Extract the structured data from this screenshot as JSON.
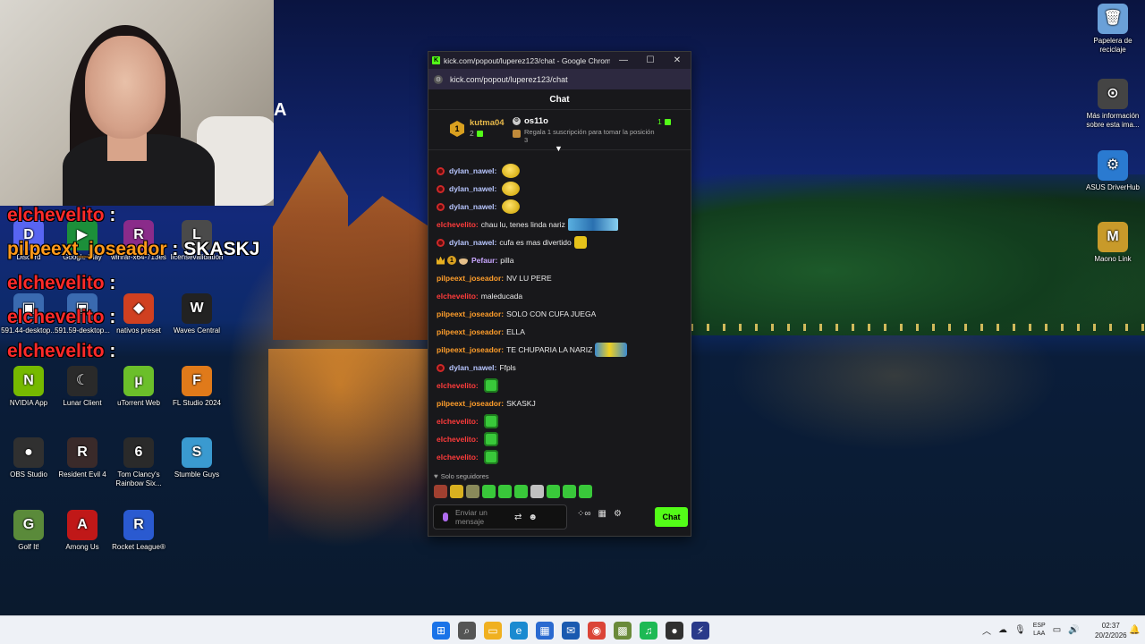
{
  "stream_overlay": {
    "letter": "A",
    "chat_lines": [
      {
        "user": "elchevelito",
        "sep": " : ",
        "text": "",
        "user_class": "user-red"
      },
      {
        "user": "pilpeext_joseador",
        "sep": " : ",
        "text": "SKASKJ",
        "user_class": "user-orange"
      },
      {
        "user": "elchevelito",
        "sep": " : ",
        "text": "",
        "user_class": "user-red"
      },
      {
        "user": "elchevelito",
        "sep": " : ",
        "text": "",
        "user_class": "user-red"
      },
      {
        "user": "elchevelito",
        "sep": " : ",
        "text": "",
        "user_class": "user-red"
      }
    ]
  },
  "desktop_icons": [
    {
      "name": "discord-icon",
      "label": "Discord",
      "color": "#5865f2",
      "glyph": "D"
    },
    {
      "name": "google-play-icon",
      "label": "Google Play",
      "color": "#1c8f3a",
      "glyph": "▶"
    },
    {
      "name": "winrar-icon",
      "label": "winrar-x64-713es",
      "color": "#8a2b8a",
      "glyph": "R"
    },
    {
      "name": "license-icon",
      "label": "licensevalidation",
      "color": "#4a4a4a",
      "glyph": "L"
    },
    {
      "name": "desktop-shortcut-icon",
      "label": "591.44-desktop...",
      "color": "#3a6ab0",
      "glyph": "▣"
    },
    {
      "name": "desktop-shortcut2-icon",
      "label": "591.59-desktop...",
      "color": "#3a6ab0",
      "glyph": "▣"
    },
    {
      "name": "nativos-preset-icon",
      "label": "nativos preset",
      "color": "#d04020",
      "glyph": "◆"
    },
    {
      "name": "waves-icon",
      "label": "Waves Central",
      "color": "#222222",
      "glyph": "W"
    },
    {
      "name": "nvidia-icon",
      "label": "NVIDIA App",
      "color": "#76b900",
      "glyph": "N"
    },
    {
      "name": "lunar-client-icon",
      "label": "Lunar Client",
      "color": "#2a2a2a",
      "glyph": "☾"
    },
    {
      "name": "utorrent-icon",
      "label": "uTorrent Web",
      "color": "#6bbf2a",
      "glyph": "µ"
    },
    {
      "name": "fl-studio-icon",
      "label": "FL Studio 2024",
      "color": "#e07a1a",
      "glyph": "F"
    },
    {
      "name": "obs-icon",
      "label": "OBS Studio",
      "color": "#303030",
      "glyph": "●"
    },
    {
      "name": "resident-evil-icon",
      "label": "Resident Evil 4",
      "color": "#3a2a2a",
      "glyph": "R"
    },
    {
      "name": "rainbow-six-icon",
      "label": "Tom Clancy's Rainbow Six...",
      "color": "#2a2a2a",
      "glyph": "6"
    },
    {
      "name": "stumble-guys-icon",
      "label": "Stumble Guys",
      "color": "#3a9ad0",
      "glyph": "S"
    },
    {
      "name": "golf-it-icon",
      "label": "Golf It!",
      "color": "#5a8a3a",
      "glyph": "G"
    },
    {
      "name": "among-us-icon",
      "label": "Among Us",
      "color": "#c01818",
      "glyph": "A"
    },
    {
      "name": "rocket-league-icon",
      "label": "Rocket League®",
      "color": "#2a5ad0",
      "glyph": "R"
    },
    {
      "name": "recycle-bin-icon",
      "label": "Papelera de reciclaje",
      "color": "#6aa0d8",
      "glyph": "🗑"
    },
    {
      "name": "info-icon",
      "label": "Más información sobre esta ima...",
      "color": "#444444",
      "glyph": "⊙"
    },
    {
      "name": "asus-driverhub-icon",
      "label": "ASUS DriverHub",
      "color": "#2a7ad0",
      "glyph": "⚙"
    },
    {
      "name": "maono-link-icon",
      "label": "Maono Link",
      "color": "#c89a2a",
      "glyph": "M"
    }
  ],
  "window": {
    "title": "kick.com/popout/luperez123/chat - Google Chrome",
    "url": "kick.com/popout/luperez123/chat",
    "minimize": "—",
    "maximize": "☐",
    "close": "✕"
  },
  "chat": {
    "header": "Chat",
    "leaderboard": {
      "rank": "1",
      "top_user": "kutma04",
      "top_count": "2",
      "second_user": "os11o",
      "second_hint": "Regala 1 suscripción para tomar la posición 3",
      "second_count": "1"
    },
    "messages": [
      {
        "badge": "kick",
        "user": "dylan_nawel",
        "user_class": "u-dylan",
        "text": "",
        "emote": "yellow"
      },
      {
        "badge": "kick",
        "user": "dylan_nawel",
        "user_class": "u-dylan",
        "text": "",
        "emote": "yellow"
      },
      {
        "badge": "kick",
        "user": "dylan_nawel",
        "user_class": "u-dylan",
        "text": "",
        "emote": "yellow"
      },
      {
        "badge": "",
        "user": "elchevelito",
        "user_class": "u-elche",
        "text": "chau lu, tenes linda nariz",
        "emote": "wide"
      },
      {
        "badge": "kick",
        "user": "dylan_nawel",
        "user_class": "u-dylan",
        "text": "cufa es mas divertido",
        "emote": "bag"
      },
      {
        "badge": "pefaur",
        "user": "Pefaur",
        "user_class": "u-pefaur",
        "text": "pilla",
        "emote": ""
      },
      {
        "badge": "",
        "user": "pilpeext_joseador",
        "user_class": "u-pilpe",
        "text": "NV LU PERE",
        "emote": ""
      },
      {
        "badge": "",
        "user": "elchevelito",
        "user_class": "u-elche",
        "text": "maleducada",
        "emote": ""
      },
      {
        "badge": "",
        "user": "pilpeext_joseador",
        "user_class": "u-pilpe",
        "text": "SOLO CON CUFA JUEGA",
        "emote": ""
      },
      {
        "badge": "",
        "user": "pilpeext_joseador",
        "user_class": "u-pilpe",
        "text": "ELLA",
        "emote": ""
      },
      {
        "badge": "",
        "user": "pilpeext_joseador",
        "user_class": "u-pilpe",
        "text": "TE CHUPARIA LA NARIZ",
        "emote": "minion"
      },
      {
        "badge": "kick",
        "user": "dylan_nawel",
        "user_class": "u-dylan",
        "text": "Ffpls",
        "emote": ""
      },
      {
        "badge": "",
        "user": "elchevelito",
        "user_class": "u-elche",
        "text": "",
        "emote": "green"
      },
      {
        "badge": "",
        "user": "pilpeext_joseador",
        "user_class": "u-pilpe",
        "text": "SKASKJ",
        "emote": ""
      },
      {
        "badge": "",
        "user": "elchevelito",
        "user_class": "u-elche",
        "text": "",
        "emote": "green"
      },
      {
        "badge": "",
        "user": "elchevelito",
        "user_class": "u-elche",
        "text": "",
        "emote": "green"
      },
      {
        "badge": "",
        "user": "elchevelito",
        "user_class": "u-elche",
        "text": "",
        "emote": "green"
      }
    ],
    "followers_only": "Solo seguidores",
    "emote_bar": [
      "#a04030",
      "#d8b020",
      "#8a8a5a",
      "#39c83a",
      "#39c83a",
      "#39c83a",
      "#c0c0c0",
      "#39c83a",
      "#39c83a",
      "#39c83a"
    ],
    "input_placeholder": "Enviar un mensaje",
    "send_label": "Chat"
  },
  "taskbar": {
    "apps": [
      {
        "name": "start-icon",
        "color": "#1a73e8",
        "glyph": "⊞"
      },
      {
        "name": "search-icon",
        "color": "#555555",
        "glyph": "⌕"
      },
      {
        "name": "file-explorer-icon",
        "color": "#f0b020",
        "glyph": "▭"
      },
      {
        "name": "edge-icon",
        "color": "#1a8ad0",
        "glyph": "e"
      },
      {
        "name": "store-icon",
        "color": "#2a6ad0",
        "glyph": "▦"
      },
      {
        "name": "outlook-icon",
        "color": "#1a5ab0",
        "glyph": "✉"
      },
      {
        "name": "chrome-icon",
        "color": "#db4437",
        "glyph": "◉"
      },
      {
        "name": "minecraft-icon",
        "color": "#6a8a3a",
        "glyph": "▩"
      },
      {
        "name": "spotify-icon",
        "color": "#1db954",
        "glyph": "♫"
      },
      {
        "name": "obs-taskbar-icon",
        "color": "#303030",
        "glyph": "●"
      },
      {
        "name": "winamp-icon",
        "color": "#2a3a8a",
        "glyph": "⚡"
      }
    ],
    "lang_top": "ESP",
    "lang_bottom": "LAA",
    "time": "02:37",
    "date": "20/2/2026"
  }
}
